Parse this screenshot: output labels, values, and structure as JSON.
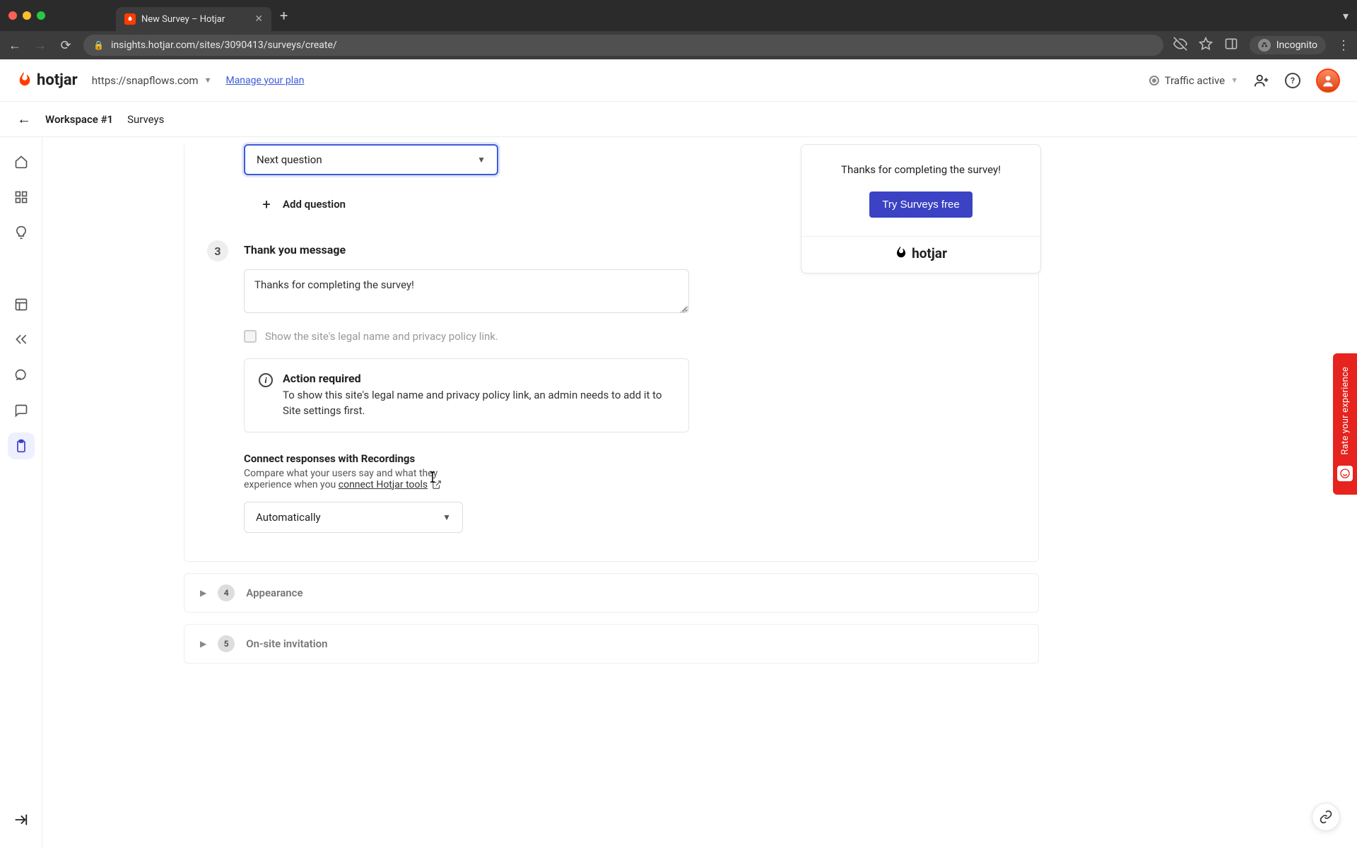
{
  "browser": {
    "tab_title": "New Survey – Hotjar",
    "url": "insights.hotjar.com/sites/3090413/surveys/create/",
    "incognito_label": "Incognito"
  },
  "header": {
    "brand": "hotjar",
    "site": "https://snapflows.com",
    "manage_plan": "Manage your plan",
    "traffic_status": "Traffic active"
  },
  "breadcrumb": {
    "workspace": "Workspace #1",
    "section": "Surveys"
  },
  "main": {
    "next_question_dropdown": "Next question",
    "add_question": "Add question",
    "step3_number": "3",
    "thank_you_title": "Thank you message",
    "thank_you_value": "Thanks for completing the survey!",
    "privacy_checkbox_label": "Show the site's legal name and privacy policy link.",
    "info_title": "Action required",
    "info_body": "To show this site's legal name and privacy policy link, an admin needs to add it to Site settings first.",
    "connect_title": "Connect responses with Recordings",
    "connect_desc_1": "Compare what your users say and what they experience when you ",
    "connect_desc_link": "connect Hotjar tools",
    "auto_dropdown": "Automatically"
  },
  "preview": {
    "message": "Thanks for completing the survey!",
    "cta": "Try Surveys free",
    "footer_brand": "hotjar"
  },
  "accordion": {
    "row4_num": "4",
    "row4_label": "Appearance",
    "row5_num": "5",
    "row5_label": "On-site invitation"
  },
  "rate_tab": "Rate your experience"
}
